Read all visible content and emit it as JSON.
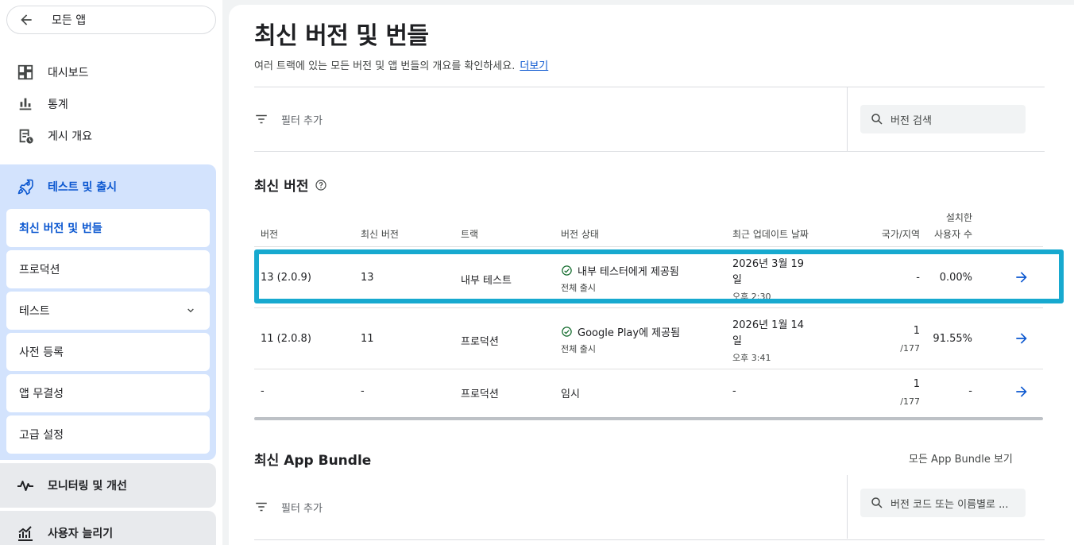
{
  "sidebar": {
    "all_apps": "모든 앱",
    "top_items": [
      {
        "label": "대시보드",
        "icon": "dashboard-icon"
      },
      {
        "label": "통계",
        "icon": "bar-chart-icon"
      },
      {
        "label": "게시 개요",
        "icon": "publishing-overview-icon"
      }
    ],
    "release_section": {
      "label": "테스트 및 출시",
      "icon": "rocket-icon",
      "items": [
        {
          "label": "최신 버전 및 번들",
          "active": true
        },
        {
          "label": "프로덕션"
        },
        {
          "label": "테스트",
          "has_chevron": true
        },
        {
          "label": "사전 등록"
        },
        {
          "label": "앱 무결성"
        },
        {
          "label": "고급 설정"
        }
      ]
    },
    "monitor": {
      "label": "모니터링 및 개선",
      "icon": "vitals-icon"
    },
    "grow": {
      "label": "사용자 늘리기",
      "icon": "grow-chart-icon"
    }
  },
  "page": {
    "title": "최신 버전 및 번들",
    "subtitle": "여러 트랙에 있는 모든 버전 및 앱 번들의 개요를 확인하세요.",
    "learn_more": "더보기"
  },
  "filter": {
    "label": "필터 추가",
    "search_placeholder": "버전 검색"
  },
  "releases": {
    "title": "최신 버전",
    "columns": {
      "version": "버전",
      "latest_version": "최신 버전",
      "track": "트랙",
      "status": "버전 상태",
      "updated": "최근 업데이트 날짜",
      "countries": "국가/지역",
      "installed_1": "설치한",
      "installed_2": "사용자 수"
    },
    "rows": [
      {
        "version": "13 (2.0.9)",
        "latest": "13",
        "track": "내부 테스트",
        "status": "내부 테스터에게 제공됨",
        "status_ok": true,
        "rollout": "전체 출시",
        "date_1": "2026년 3월 19",
        "date_2": "일",
        "time": "오후 2:30",
        "countries": "-",
        "countries_total": "",
        "installed": "0.00%"
      },
      {
        "version": "11 (2.0.8)",
        "latest": "11",
        "track": "프로덕션",
        "status": "Google Play에 제공됨",
        "status_ok": true,
        "rollout": "전체 출시",
        "date_1": "2026년 1월 14",
        "date_2": "일",
        "time": "오후 3:41",
        "countries": "1",
        "countries_total": "/177",
        "installed": "91.55%"
      },
      {
        "version": "-",
        "latest": "-",
        "track": "프로덕션",
        "status": "임시",
        "status_ok": false,
        "rollout": "",
        "date_1": "-",
        "date_2": "",
        "time": "",
        "countries": "1",
        "countries_total": "/177",
        "installed": "-"
      }
    ]
  },
  "bundles": {
    "title": "최신 App Bundle",
    "view_all": "모든 App Bundle 보기",
    "filter_label": "필터 추가",
    "search_placeholder": "버전 코드 또는 이름별로 ..."
  },
  "colors": {
    "accent": "#0b57d0",
    "highlight": "#17a9cf",
    "success": "#146c2e",
    "nav_active_bg": "#d3e3fd"
  }
}
